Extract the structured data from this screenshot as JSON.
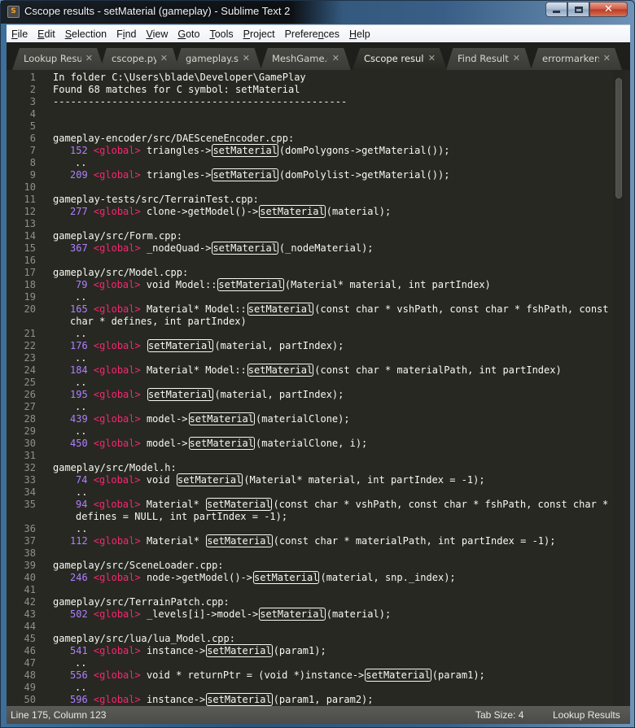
{
  "window": {
    "title": "Cscope results - setMaterial (gameplay) - Sublime Text 2",
    "app_icon_letter": "S",
    "controls": {
      "minimize": "minimize",
      "maximize": "maximize",
      "close": "✕"
    }
  },
  "menu": [
    {
      "label": "File",
      "mnemonic": "F"
    },
    {
      "label": "Edit",
      "mnemonic": "E"
    },
    {
      "label": "Selection",
      "mnemonic": "S"
    },
    {
      "label": "Find",
      "mnemonic": "i"
    },
    {
      "label": "View",
      "mnemonic": "V"
    },
    {
      "label": "Goto",
      "mnemonic": "G"
    },
    {
      "label": "Tools",
      "mnemonic": "T"
    },
    {
      "label": "Project",
      "mnemonic": "P"
    },
    {
      "label": "Preferences",
      "mnemonic": "n"
    },
    {
      "label": "Help",
      "mnemonic": "H"
    }
  ],
  "tabs": [
    {
      "label": "Lookup Result",
      "active": false
    },
    {
      "label": "cscope.py",
      "active": false
    },
    {
      "label": "gameplay.subl",
      "active": false
    },
    {
      "label": "MeshGame.cpp",
      "active": false
    },
    {
      "label": "Cscope results",
      "active": true
    },
    {
      "label": "Find Results",
      "active": false
    },
    {
      "label": "errormarkers.py",
      "active": false
    }
  ],
  "tab_close_glyph": "✕",
  "editor": {
    "symbol": "setMaterial",
    "lines": [
      {
        "n": "1",
        "kind": "plain",
        "text": "In folder C:\\Users\\blade\\Developer\\GamePlay"
      },
      {
        "n": "2",
        "kind": "plain",
        "text": "Found 68 matches for C symbol: setMaterial"
      },
      {
        "n": "3",
        "kind": "plain",
        "text": "--------------------------------------------------"
      },
      {
        "n": "4",
        "kind": "blank",
        "text": ""
      },
      {
        "n": "5",
        "kind": "blank",
        "text": ""
      },
      {
        "n": "6",
        "kind": "file",
        "text": "gameplay-encoder/src/DAESceneEncoder.cpp:"
      },
      {
        "n": "7",
        "kind": "match",
        "num": "152",
        "tag": "<global>",
        "pre": "triangles->",
        "post": "(domPolygons->getMaterial());"
      },
      {
        "n": "8",
        "kind": "dots",
        "text": ".."
      },
      {
        "n": "9",
        "kind": "match",
        "num": "209",
        "tag": "<global>",
        "pre": "triangles->",
        "post": "(domPolylist->getMaterial());"
      },
      {
        "n": "10",
        "kind": "blank",
        "text": ""
      },
      {
        "n": "11",
        "kind": "file",
        "text": "gameplay-tests/src/TerrainTest.cpp:"
      },
      {
        "n": "12",
        "kind": "match",
        "num": "277",
        "tag": "<global>",
        "pre": "clone->getModel()->",
        "post": "(material);"
      },
      {
        "n": "13",
        "kind": "blank",
        "text": ""
      },
      {
        "n": "14",
        "kind": "file",
        "text": "gameplay/src/Form.cpp:"
      },
      {
        "n": "15",
        "kind": "match",
        "num": "367",
        "tag": "<global>",
        "pre": "_nodeQuad->",
        "post": "(_nodeMaterial);"
      },
      {
        "n": "16",
        "kind": "blank",
        "text": ""
      },
      {
        "n": "17",
        "kind": "file",
        "text": "gameplay/src/Model.cpp:"
      },
      {
        "n": "18",
        "kind": "match",
        "num": " 79",
        "tag": "<global>",
        "pre": "void Model::",
        "post": "(Material* material, int partIndex)"
      },
      {
        "n": "19",
        "kind": "dots",
        "text": ".."
      },
      {
        "n": "20",
        "kind": "match",
        "num": "165",
        "tag": "<global>",
        "pre": "Material* Model::",
        "post": "(const char * vshPath, const char * fshPath, const"
      },
      {
        "n": "",
        "kind": "wrap",
        "text": "char * defines, int partIndex)"
      },
      {
        "n": "21",
        "kind": "dots",
        "text": ".."
      },
      {
        "n": "22",
        "kind": "match",
        "num": "176",
        "tag": "<global>",
        "pre": "",
        "post": "(material, partIndex);"
      },
      {
        "n": "23",
        "kind": "dots",
        "text": ".."
      },
      {
        "n": "24",
        "kind": "match",
        "num": "184",
        "tag": "<global>",
        "pre": "Material* Model::",
        "post": "(const char * materialPath, int partIndex)"
      },
      {
        "n": "25",
        "kind": "dots",
        "text": ".."
      },
      {
        "n": "26",
        "kind": "match",
        "num": "195",
        "tag": "<global>",
        "pre": "",
        "post": "(material, partIndex);"
      },
      {
        "n": "27",
        "kind": "dots",
        "text": ".."
      },
      {
        "n": "28",
        "kind": "match",
        "num": "439",
        "tag": "<global>",
        "pre": "model->",
        "post": "(materialClone);"
      },
      {
        "n": "29",
        "kind": "dots",
        "text": ".."
      },
      {
        "n": "30",
        "kind": "match",
        "num": "450",
        "tag": "<global>",
        "pre": "model->",
        "post": "(materialClone, i);"
      },
      {
        "n": "31",
        "kind": "blank",
        "text": ""
      },
      {
        "n": "32",
        "kind": "file",
        "text": "gameplay/src/Model.h:"
      },
      {
        "n": "33",
        "kind": "match",
        "num": " 74",
        "tag": "<global>",
        "pre": "void ",
        "post": "(Material* material, int partIndex = -1);"
      },
      {
        "n": "34",
        "kind": "dots2",
        "text": ".."
      },
      {
        "n": "35",
        "kind": "match",
        "num": " 94",
        "tag": "<global>",
        "pre": "Material* ",
        "post": "(const char * vshPath, const char * fshPath, const char *"
      },
      {
        "n": "",
        "kind": "wrap2",
        "text": "defines = NULL, int partIndex = -1);"
      },
      {
        "n": "36",
        "kind": "dots2",
        "text": ".."
      },
      {
        "n": "37",
        "kind": "match",
        "num": "112",
        "tag": "<global>",
        "pre": "Material* ",
        "post": "(const char * materialPath, int partIndex = -1);"
      },
      {
        "n": "38",
        "kind": "blank",
        "text": ""
      },
      {
        "n": "39",
        "kind": "file",
        "text": "gameplay/src/SceneLoader.cpp:"
      },
      {
        "n": "40",
        "kind": "match",
        "num": "246",
        "tag": "<global>",
        "pre": "node->getModel()->",
        "post": "(material, snp._index);"
      },
      {
        "n": "41",
        "kind": "blank",
        "text": ""
      },
      {
        "n": "42",
        "kind": "file",
        "text": "gameplay/src/TerrainPatch.cpp:"
      },
      {
        "n": "43",
        "kind": "match",
        "num": "502",
        "tag": "<global>",
        "pre": "_levels[i]->model->",
        "post": "(material);"
      },
      {
        "n": "44",
        "kind": "blank",
        "text": ""
      },
      {
        "n": "45",
        "kind": "file",
        "text": "gameplay/src/lua/lua_Model.cpp:"
      },
      {
        "n": "46",
        "kind": "match",
        "num": "541",
        "tag": "<global>",
        "pre": "instance->",
        "post": "(param1);"
      },
      {
        "n": "47",
        "kind": "dots",
        "text": ".."
      },
      {
        "n": "48",
        "kind": "match",
        "num": "556",
        "tag": "<global>",
        "pre": "void * returnPtr = (void *)instance->",
        "post": "(param1);"
      },
      {
        "n": "49",
        "kind": "dots",
        "text": ".."
      },
      {
        "n": "50",
        "kind": "match",
        "num": "596",
        "tag": "<global>",
        "pre": "instance->",
        "post": "(param1, param2);"
      }
    ]
  },
  "status": {
    "position": "Line 175, Column 123",
    "tab_size": "Tab Size: 4",
    "syntax": "Lookup Results"
  }
}
